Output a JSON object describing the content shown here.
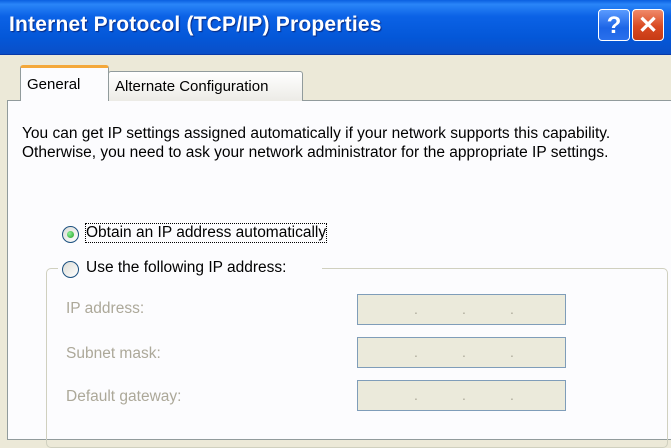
{
  "window": {
    "title": "Internet Protocol (TCP/IP) Properties",
    "help_label": "?",
    "close_label": "✕"
  },
  "tabs": [
    {
      "label": "General",
      "active": true
    },
    {
      "label": "Alternate Configuration",
      "active": false
    }
  ],
  "general": {
    "description": "You can get IP settings assigned automatically if your network supports this capability. Otherwise, you need to ask your network administrator for the appropriate IP settings.",
    "radio_auto": {
      "label": "Obtain an IP address automatically",
      "selected": true
    },
    "radio_manual": {
      "label": "Use the following IP address:",
      "selected": false
    },
    "fields": [
      {
        "label": "IP address:",
        "value": ". . ."
      },
      {
        "label": "Subnet mask:",
        "value": ". . ."
      },
      {
        "label": "Default gateway:",
        "value": ". . ."
      }
    ]
  },
  "colors": {
    "titlebar": "#0457d8",
    "dialog_bg": "#ece9d8",
    "panel_bg": "#fcfcfe",
    "tab_accent": "#f4a83a",
    "disabled_text": "#aca899"
  }
}
